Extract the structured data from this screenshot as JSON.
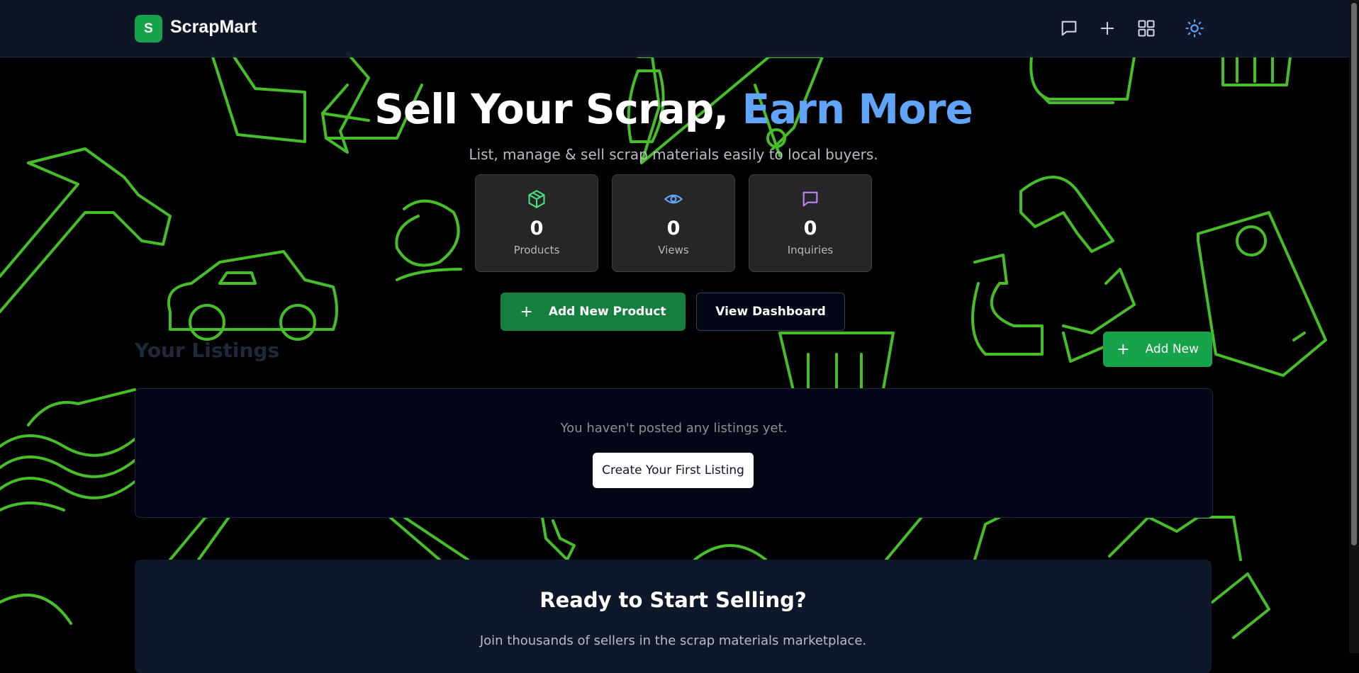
{
  "brand": {
    "badge": "S",
    "name": "ScrapMart"
  },
  "nav": {
    "icons": [
      "message-icon",
      "plus-icon",
      "grid-icon",
      "sun-icon"
    ],
    "accent_color": "#60a5fa"
  },
  "hero": {
    "title_main": "Sell Your Scrap,",
    "title_accent": "Earn More",
    "subtitle": "List, manage & sell scrap materials easily to local buyers."
  },
  "stats": [
    {
      "icon": "package-icon",
      "value": "0",
      "label": "Products",
      "color": "#4ade80"
    },
    {
      "icon": "eye-icon",
      "value": "0",
      "label": "Views",
      "color": "#60a5fa"
    },
    {
      "icon": "message-icon",
      "value": "0",
      "label": "Inquiries",
      "color": "#c084fc"
    }
  ],
  "actions": {
    "add_product": "Add New Product",
    "view_dashboard": "View Dashboard"
  },
  "listings": {
    "title": "Your Listings",
    "add_new": "Add New",
    "empty_text": "You haven't posted any listings yet.",
    "create_first": "Create Your First Listing"
  },
  "cta": {
    "title": "Ready to Start Selling?",
    "subtitle": "Join thousands of sellers in the scrap materials marketplace."
  },
  "colors": {
    "brand_green": "#16a34a",
    "outline_green": "#4ac92a",
    "background": "#000000"
  }
}
